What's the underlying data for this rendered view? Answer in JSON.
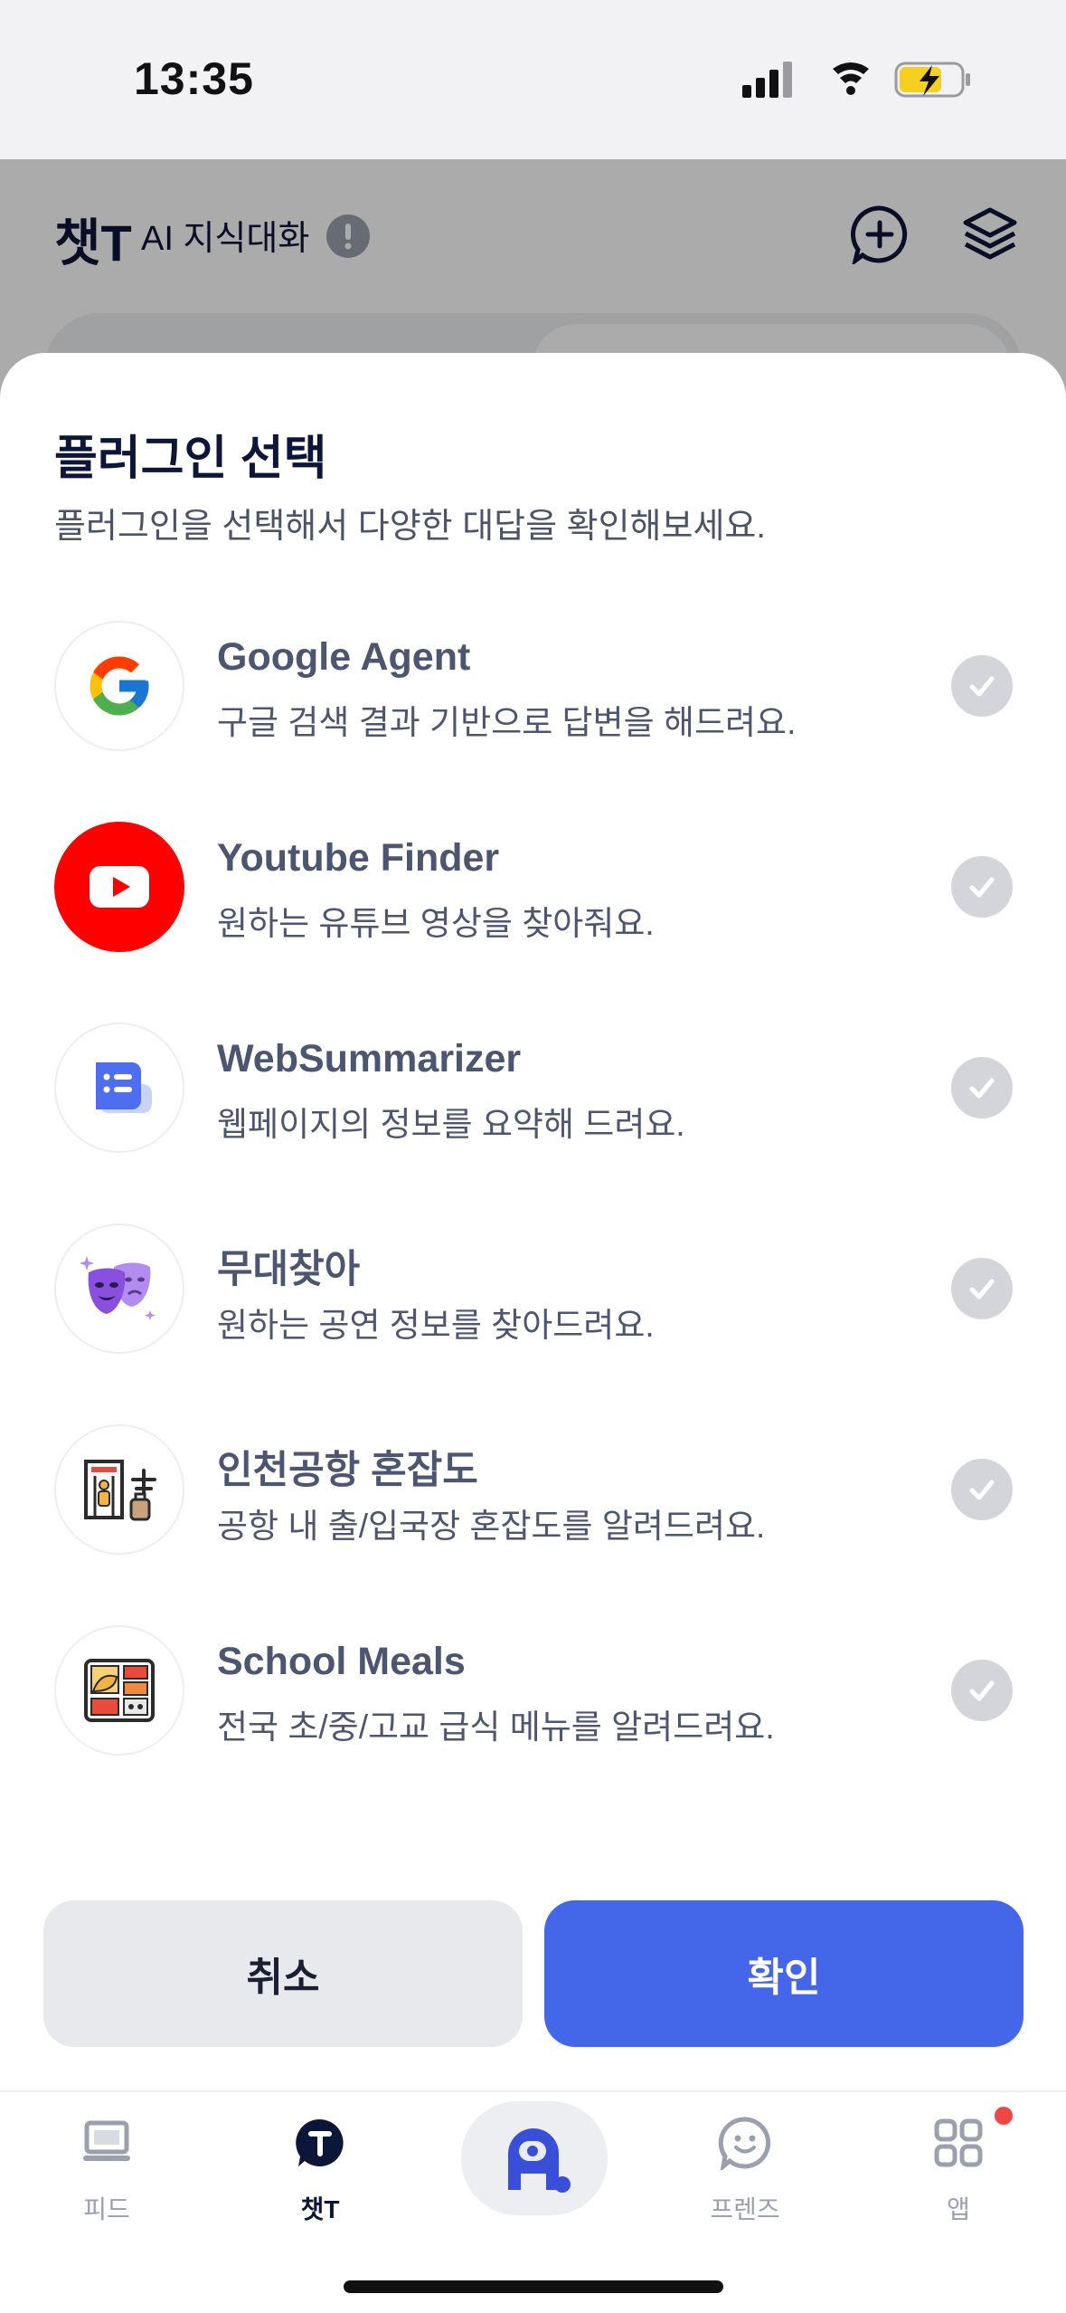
{
  "status_bar": {
    "time": "13:35"
  },
  "app_header": {
    "brand": "챗T",
    "subtitle": "AI 지식대화"
  },
  "sheet": {
    "title": "플러그인 선택",
    "subtitle": "플러그인을 선택해서 다양한 대답을 확인해보세요.",
    "plugins": [
      {
        "name": "Google Agent",
        "description": "구글 검색 결과 기반으로 답변을 해드려요.",
        "icon": "google-logo",
        "selected": false
      },
      {
        "name": "Youtube Finder",
        "description": "원하는 유튜브 영상을 찾아줘요.",
        "icon": "youtube-logo",
        "selected": false
      },
      {
        "name": "WebSummarizer",
        "description": "웹페이지의 정보를 요약해 드려요.",
        "icon": "document-list-icon",
        "selected": false
      },
      {
        "name": "무대찾아",
        "description": "원하는 공연 정보를 찾아드려요.",
        "icon": "theater-masks-icon",
        "selected": false
      },
      {
        "name": "인천공항 혼잡도",
        "description": "공항 내 출/입국장 혼잡도를 알려드려요.",
        "icon": "airport-gate-icon",
        "selected": false
      },
      {
        "name": "School Meals",
        "description": "전국 초/중/고교 급식 메뉴를 알려드려요.",
        "icon": "meal-tray-icon",
        "selected": false
      }
    ],
    "cancel_label": "취소",
    "confirm_label": "확인"
  },
  "tab_bar": {
    "tabs": [
      {
        "label": "피드",
        "icon": "laptop-icon",
        "active": false
      },
      {
        "label": "챗T",
        "icon": "chat-t-icon",
        "active": true
      },
      {
        "label": "",
        "icon": "a-dot-logo",
        "active": false
      },
      {
        "label": "프렌즈",
        "icon": "smile-bubble-icon",
        "active": false
      },
      {
        "label": "앱",
        "icon": "apps-grid-icon",
        "active": false,
        "has_badge": true
      }
    ]
  },
  "colors": {
    "primary": "#4466e8",
    "title": "#0c1638",
    "muted_check": "#d3d5db",
    "badge": "#f04646"
  }
}
